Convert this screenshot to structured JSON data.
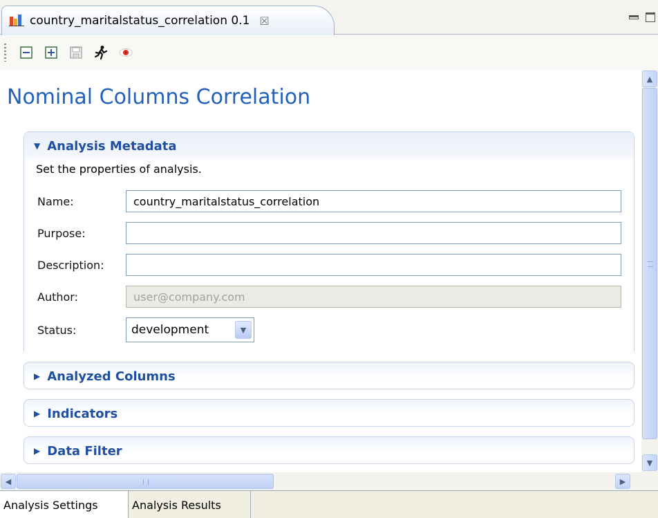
{
  "editor_tab": {
    "title": "country_maritalstatus_correlation 0.1",
    "icon": "bar-chart-icon",
    "close_icon": "close-icon"
  },
  "toolbar": {
    "items": [
      {
        "name": "collapse-all-button",
        "icon": "collapse-all-icon"
      },
      {
        "name": "expand-all-button",
        "icon": "expand-all-icon"
      },
      {
        "name": "save-button",
        "icon": "save-icon"
      },
      {
        "name": "run-button",
        "icon": "run-icon"
      },
      {
        "name": "preview-button",
        "icon": "eye-icon"
      }
    ]
  },
  "page": {
    "title": "Nominal Columns Correlation"
  },
  "metadata": {
    "header": "Analysis Metadata",
    "description": "Set the properties of analysis.",
    "name_label": "Name:",
    "name_value": "country_maritalstatus_correlation",
    "purpose_label": "Purpose:",
    "purpose_value": "",
    "description_label": "Description:",
    "description_value": "",
    "author_label": "Author:",
    "author_placeholder": "user@company.com",
    "status_label": "Status:",
    "status_value": "development"
  },
  "sections": {
    "analyzed_columns": "Analyzed Columns",
    "indicators": "Indicators",
    "data_filter": "Data Filter"
  },
  "page_tabs": {
    "settings": "Analysis Settings",
    "results": "Analysis Results"
  },
  "colors": {
    "title_blue": "#2460b8",
    "section_blue": "#1f4fa0",
    "field_border": "#7f9db9"
  }
}
